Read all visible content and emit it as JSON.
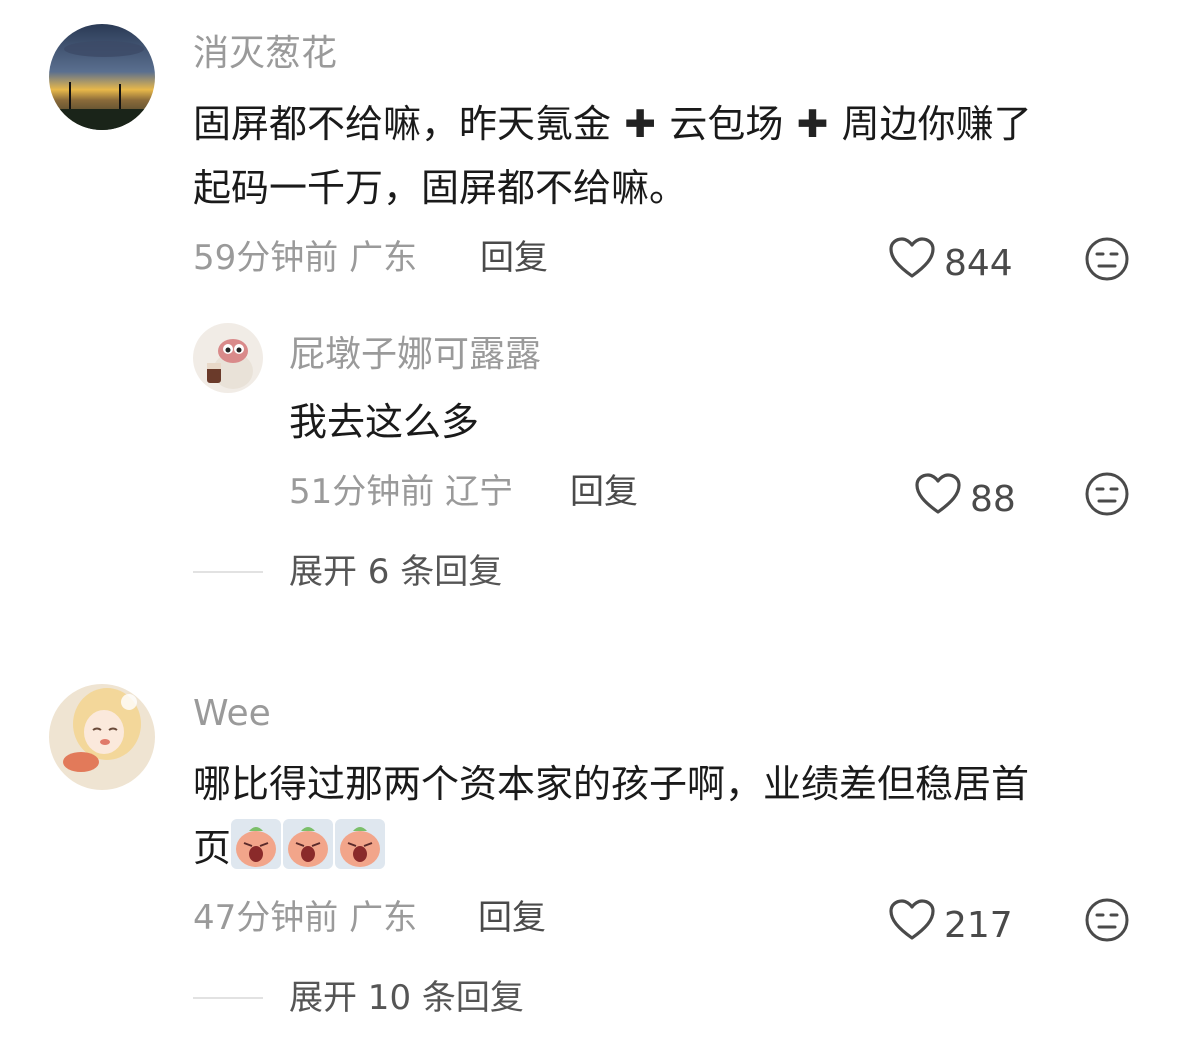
{
  "comments": [
    {
      "username": "消灭葱花",
      "text_parts": [
        "固屏都不给嘛，昨天氪金",
        "云包场",
        "周边你赚了",
        "起码一千万，固屏都不给嘛。"
      ],
      "time": "59分钟前",
      "location": "广东",
      "reply_label": "回复",
      "likes": "844",
      "expand_label": "展开 6 条回复",
      "reply": {
        "username": "屁墩子娜可露露",
        "text": "我去这么多",
        "time": "51分钟前",
        "location": "辽宁",
        "reply_label": "回复",
        "likes": "88"
      }
    },
    {
      "username": "Wee",
      "text_line1": "哪比得过那两个资本家的孩子啊，业绩差但稳居首",
      "text_line2": "页",
      "stickers": [
        "crying-sticker-icon",
        "crying-sticker-icon",
        "crying-sticker-icon"
      ],
      "time": "47分钟前",
      "location": "广东",
      "reply_label": "回复",
      "likes": "217",
      "expand_label": "展开 10 条回复"
    }
  ],
  "icons": {
    "like": "heart-outline-icon",
    "dislike": "meh-face-icon",
    "plus": "plus-icon"
  },
  "colors": {
    "muted_text": "#9a9a9a",
    "main_text": "#1a1a1a",
    "background": "#ffffff"
  }
}
